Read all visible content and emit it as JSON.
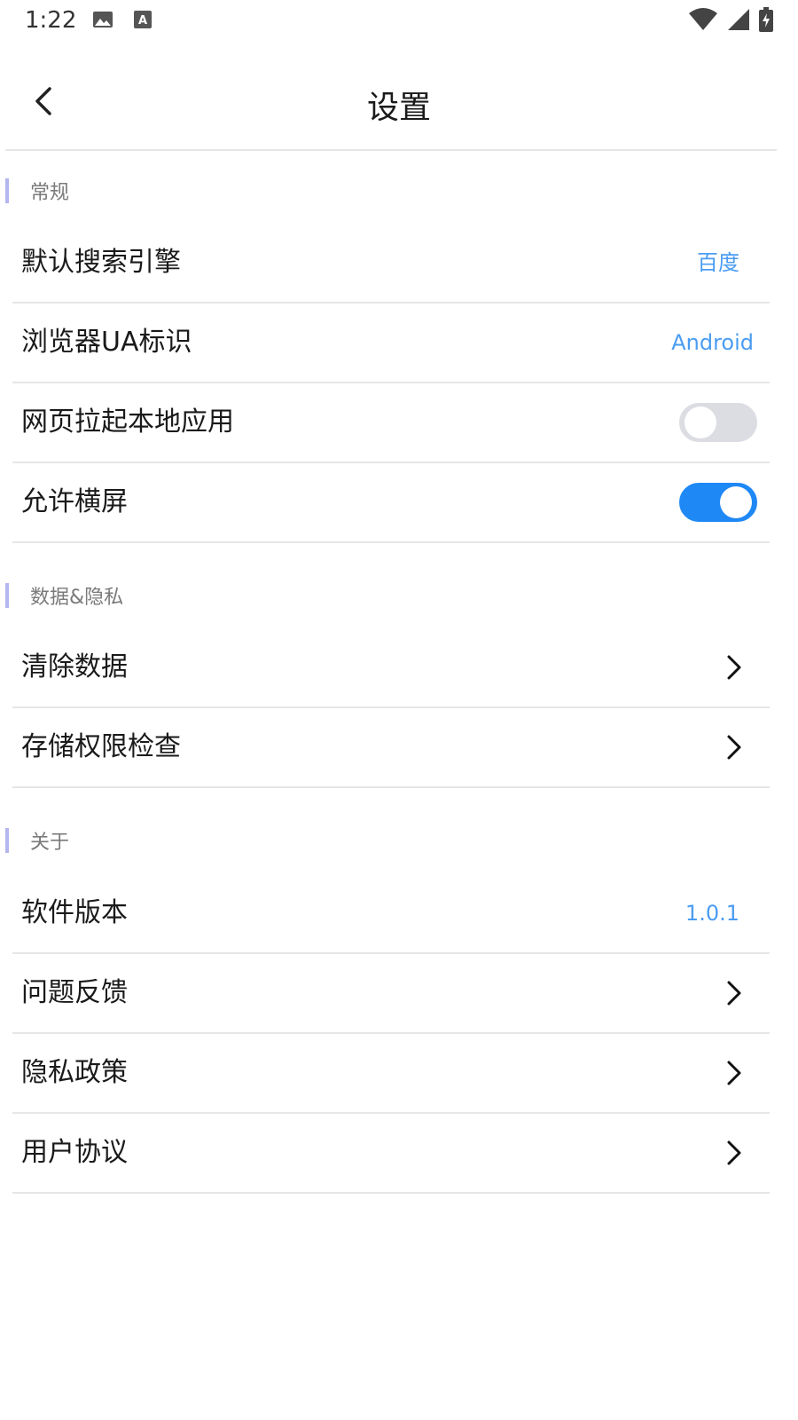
{
  "status_bar": {
    "time": "1:22",
    "icons": [
      "image-icon",
      "keyboard-a-icon",
      "wifi-icon",
      "signal-icon",
      "battery-charging-icon"
    ]
  },
  "header": {
    "title": "设置",
    "back_icon": "back-arrow-icon"
  },
  "sections": {
    "general": {
      "title": "常规",
      "rows": {
        "search_engine": {
          "label": "默认搜索引擎",
          "value": "百度"
        },
        "ua": {
          "label": "浏览器UA标识",
          "value": "Android"
        },
        "open_apps": {
          "label": "网页拉起本地应用",
          "toggle": "off"
        },
        "landscape": {
          "label": "允许横屏",
          "toggle": "on"
        }
      }
    },
    "privacy": {
      "title": "数据&隐私",
      "rows": {
        "clear_data": {
          "label": "清除数据"
        },
        "storage_check": {
          "label": "存储权限检查"
        }
      }
    },
    "about": {
      "title": "关于",
      "rows": {
        "version": {
          "label": "软件版本",
          "value": "1.0.1"
        },
        "feedback": {
          "label": "问题反馈"
        },
        "privacy_policy": {
          "label": "隐私政策"
        },
        "user_agreement": {
          "label": "用户协议"
        }
      }
    }
  },
  "colors": {
    "accent": "#1e88f5",
    "value_text": "#4a9cf2",
    "section_bar": "#b4b6ee",
    "divider": "#e6e6e6"
  }
}
